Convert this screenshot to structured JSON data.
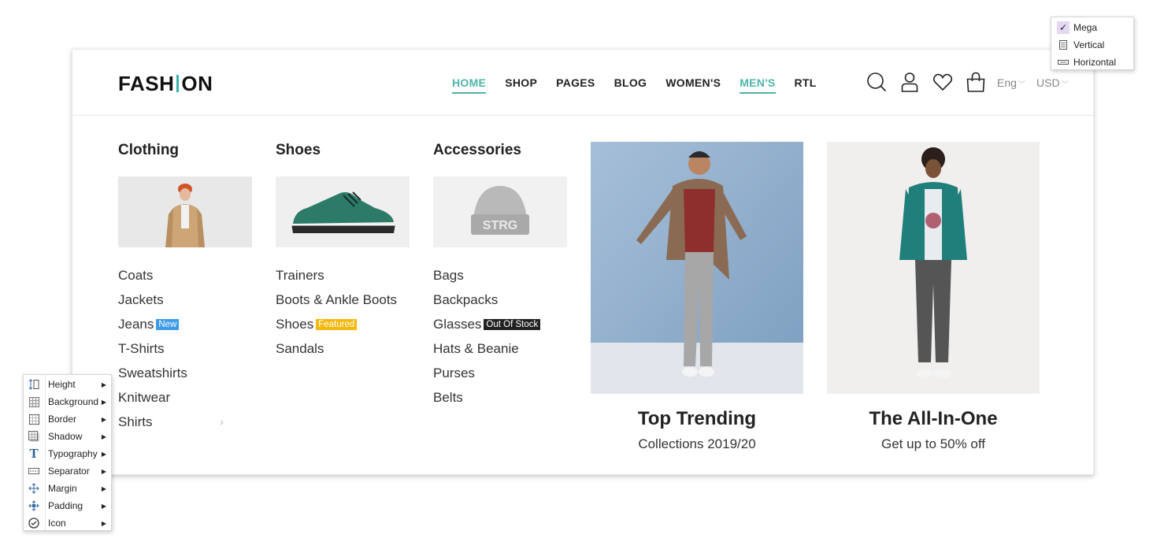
{
  "brand": {
    "logo_left": "FASH",
    "logo_right": "ON",
    "accent": "#4fb3aa"
  },
  "nav": [
    {
      "label": "HOME",
      "active": true
    },
    {
      "label": "SHOP",
      "active": false
    },
    {
      "label": "PAGES",
      "active": false
    },
    {
      "label": "BLOG",
      "active": false
    },
    {
      "label": "WOMEN'S",
      "active": false
    },
    {
      "label": "MEN'S",
      "active": true
    },
    {
      "label": "RTL",
      "active": false
    }
  ],
  "header_icons": [
    "search-icon",
    "user-icon",
    "heart-icon",
    "bag-icon"
  ],
  "language": "Eng",
  "currency": "USD",
  "columns": [
    {
      "title": "Clothing",
      "items": [
        "Coats",
        "Jackets",
        "Jeans",
        "T-Shirts",
        "Sweatshirts",
        "Knitwear",
        "Shirts"
      ]
    },
    {
      "title": "Shoes",
      "items": [
        "Trainers",
        "Boots & Ankle Boots",
        "Shoes",
        "Sandals"
      ]
    },
    {
      "title": "Accessories",
      "items": [
        "Bags",
        "Backpacks",
        "Glasses",
        "Hats & Beanie",
        "Purses",
        "Belts"
      ]
    }
  ],
  "badges": {
    "new": {
      "label": "New",
      "color": "#3d9be9"
    },
    "featured": {
      "label": "Featured",
      "color": "#f5b80c"
    },
    "out_of_stock": {
      "label": "Out Of Stock",
      "color": "#222222"
    }
  },
  "beanie_text": "STRG",
  "promos": [
    {
      "title": "Top Trending",
      "subtitle": "Collections 2019/20"
    },
    {
      "title": "The All-In-One",
      "subtitle": "Get up to 50% off"
    }
  ],
  "menu_style_options": [
    {
      "label": "Mega",
      "checked": true,
      "icon": "check-icon"
    },
    {
      "label": "Vertical",
      "checked": false,
      "icon": "vertical-list-icon"
    },
    {
      "label": "Horizontal",
      "checked": false,
      "icon": "horizontal-bar-icon"
    }
  ],
  "style_menu": [
    {
      "label": "Height",
      "icon": "height-icon"
    },
    {
      "label": "Background",
      "icon": "background-icon"
    },
    {
      "label": "Border",
      "icon": "border-icon"
    },
    {
      "label": "Shadow",
      "icon": "shadow-icon"
    },
    {
      "label": "Typography",
      "icon": "typography-icon"
    },
    {
      "label": "Separator",
      "icon": "separator-icon"
    },
    {
      "label": "Margin",
      "icon": "margin-icon"
    },
    {
      "label": "Padding",
      "icon": "padding-icon"
    },
    {
      "label": "Icon",
      "icon": "icon-icon"
    }
  ]
}
